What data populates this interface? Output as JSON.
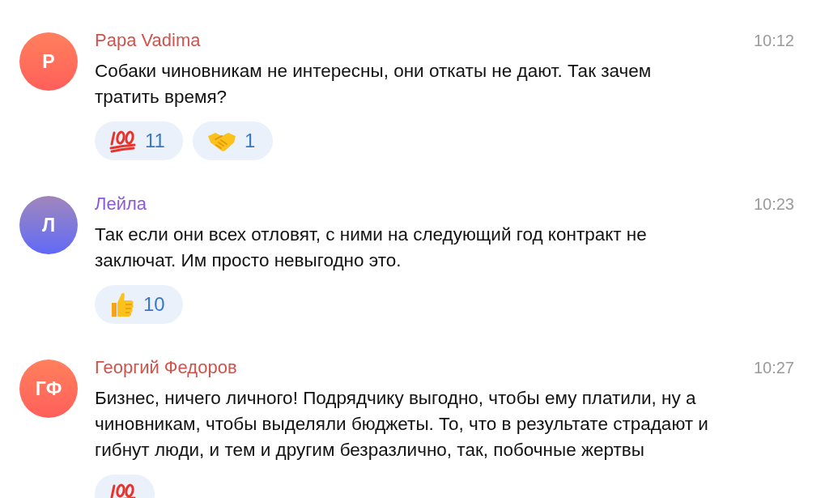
{
  "messages": [
    {
      "author": "Papa Vadima",
      "color": "#cf534d",
      "avatar": {
        "initials": "P",
        "color": "#ff5f5a"
      },
      "time": "10:12",
      "text": "Собаки чиновникам не интересны, они откаты не дают. Так зачем тратить время?",
      "reactions": [
        {
          "kind": "hundred",
          "count": "11"
        },
        {
          "kind": "handshake",
          "count": "1"
        }
      ]
    },
    {
      "author": "Лейла",
      "color": "#8a5ad8",
      "avatar": {
        "initials": "Л",
        "color": "#6168f7"
      },
      "time": "10:23",
      "text": "Так если они всех отловят, с ними на следующий год контракт не заключат. Им просто невыгодно это.",
      "reactions": [
        {
          "kind": "thumbs-up",
          "count": "10"
        }
      ]
    },
    {
      "author": "Георгий Федоров",
      "color": "#cf534d",
      "avatar": {
        "initials": "ГФ",
        "color": "#ff5f5a"
      },
      "time": "10:27",
      "text": "Бизнес, ничего личного! Подрядчику выгодно, чтобы ему платили, ну а чиновникам, чтобы выделяли бюджеты. То, что в результате страдают и гибнут люди, и тем и другим безразлично, так, побочные жертвы",
      "reactions": [
        {
          "kind": "hundred"
        }
      ]
    }
  ]
}
